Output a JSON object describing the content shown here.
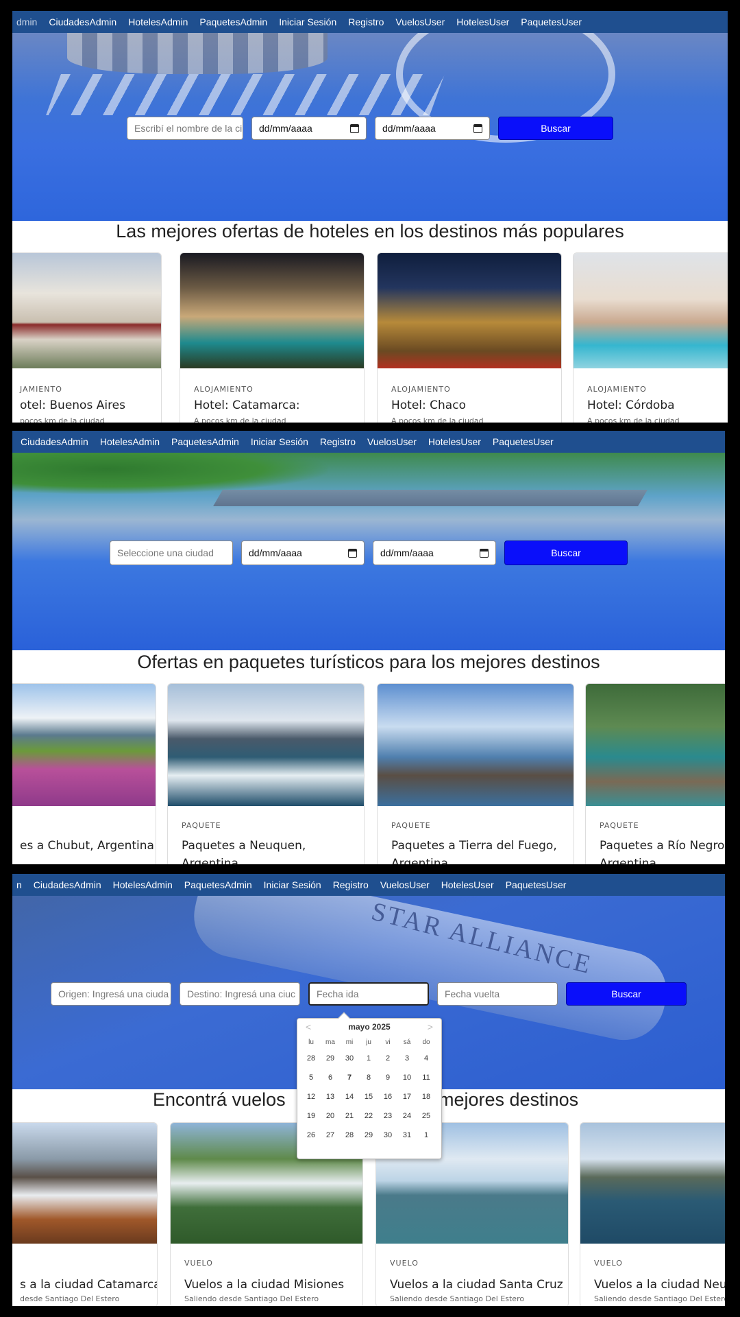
{
  "panels": [
    {
      "nav": [
        "dmin",
        "CiudadesAdmin",
        "HotelesAdmin",
        "PaquetesAdmin",
        "Iniciar Sesión",
        "Registro",
        "VuelosUser",
        "HotelesUser",
        "PaquetesUser"
      ],
      "search": {
        "text_placeholder": "Escribí el nombre de la ci",
        "date_from": "dd/mm/aaaa",
        "date_to": "dd/mm/aaaa",
        "button": "Buscar"
      },
      "section_title": "Las mejores ofertas de hoteles en los destinos más populares",
      "cards": [
        {
          "category": "JAMIENTO",
          "name": "otel: Buenos Aires",
          "sub": "pocos km de la ciudad"
        },
        {
          "category": "ALOJAMIENTO",
          "name": "Hotel: Catamarca:",
          "sub": "A pocos km de la ciudad"
        },
        {
          "category": "ALOJAMIENTO",
          "name": "Hotel: Chaco",
          "sub": "A pocos km de la ciudad"
        },
        {
          "category": "ALOJAMIENTO",
          "name": "Hotel: Córdoba",
          "sub": "A pocos km de la ciudad"
        }
      ]
    },
    {
      "nav": [
        "CiudadesAdmin",
        "HotelesAdmin",
        "PaquetesAdmin",
        "Iniciar Sesión",
        "Registro",
        "VuelosUser",
        "HotelesUser",
        "PaquetesUser"
      ],
      "search": {
        "text_placeholder": "Seleccione una ciudad",
        "date_from": "dd/mm/aaaa",
        "date_to": "dd/mm/aaaa",
        "button": "Buscar"
      },
      "section_title": "Ofertas en paquetes turísticos para los mejores destinos",
      "cards": [
        {
          "category": "",
          "name": "es a Chubut, Argentina",
          "sub": ""
        },
        {
          "category": "PAQUETE",
          "name": "Paquetes a Neuquen,",
          "sub": "Argentina"
        },
        {
          "category": "PAQUETE",
          "name": "Paquetes a Tierra del Fuego,",
          "sub": "Argentina"
        },
        {
          "category": "PAQUETE",
          "name": "Paquetes a Río Negro,",
          "sub": "Argentina"
        }
      ]
    },
    {
      "nav": [
        "n",
        "CiudadesAdmin",
        "HotelesAdmin",
        "PaquetesAdmin",
        "Iniciar Sesión",
        "Registro",
        "VuelosUser",
        "HotelesUser",
        "PaquetesUser"
      ],
      "search": {
        "origin_placeholder": "Origen: Ingresá una ciuda",
        "dest_placeholder": "Destino: Ingresá una ciuc",
        "ida_placeholder": "Fecha ida",
        "vuelta_placeholder": "Fecha vuelta",
        "button": "Buscar"
      },
      "section_title_left": "Encontrá vuelos",
      "section_title_right": "mejores destinos",
      "cards": [
        {
          "category": "",
          "name": "s a la ciudad Catamarca",
          "sub": "desde Santiago Del Estero"
        },
        {
          "category": "VUELO",
          "name": "Vuelos a la ciudad Misiones",
          "sub": "Saliendo desde Santiago Del Estero"
        },
        {
          "category": "VUELO",
          "name": "Vuelos a la ciudad Santa Cruz",
          "sub": "Saliendo desde Santiago Del Estero"
        },
        {
          "category": "VUELO",
          "name": "Vuelos a la ciudad Neuq",
          "sub": "Saliendo desde Santiago Del Estero"
        }
      ],
      "hero_text": "STAR ALLIANCE"
    }
  ],
  "datepicker": {
    "month": "mayo 2025",
    "prev": "<",
    "next": ">",
    "weekdays": [
      "lu",
      "ma",
      "mi",
      "ju",
      "vi",
      "sá",
      "do"
    ],
    "days": [
      "28",
      "29",
      "30",
      "1",
      "2",
      "3",
      "4",
      "5",
      "6",
      "7",
      "8",
      "9",
      "10",
      "11",
      "12",
      "13",
      "14",
      "15",
      "16",
      "17",
      "18",
      "19",
      "20",
      "21",
      "22",
      "23",
      "24",
      "25",
      "26",
      "27",
      "28",
      "29",
      "30",
      "31",
      "1"
    ],
    "today": "7"
  }
}
